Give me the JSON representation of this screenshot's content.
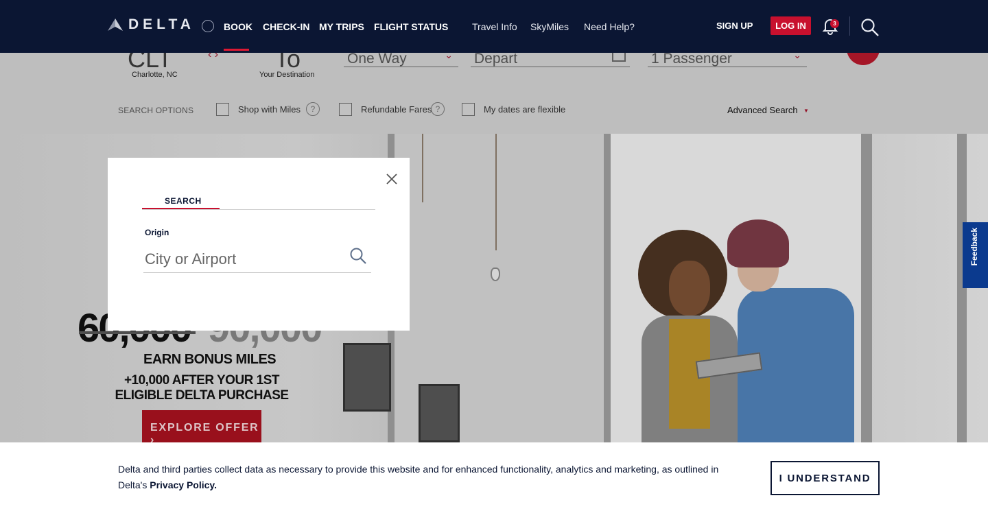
{
  "nav": {
    "brand": "DELTA",
    "items": [
      "BOOK",
      "CHECK-IN",
      "MY TRIPS",
      "FLIGHT STATUS"
    ],
    "secondary": [
      "Travel Info",
      "SkyMiles",
      "Need Help?"
    ],
    "sign_up": "SIGN UP",
    "log_in": "LOG IN",
    "notification_count": "3"
  },
  "booking": {
    "from_code": "CLT",
    "from_city": "Charlotte, NC",
    "to_code": "To",
    "to_city": "Your Destination",
    "trip_type": "One Way",
    "depart": "Depart",
    "passengers": "1 Passenger",
    "search_options_label": "SEARCH OPTIONS",
    "options": [
      "Shop with Miles",
      "Refundable Fares",
      "My dates are flexible"
    ],
    "advanced_search": "Advanced Search"
  },
  "promo": {
    "new_amount": "60,000",
    "old_amount": "90,000",
    "earn": "EARN BONUS MILES",
    "bonus": "+10,000 AFTER YOUR 1ST ELIGIBLE DELTA PURCHASE",
    "cta": "EXPLORE OFFER ›"
  },
  "feedback": "Feedback",
  "modal": {
    "tab": "SEARCH",
    "origin_label": "Origin",
    "origin_placeholder": "City or Airport"
  },
  "cookie": {
    "text": "Delta and third parties collect data as necessary to provide this website and for enhanced functionality, analytics and marketing, as outlined in Delta's ",
    "link": "Privacy Policy.",
    "button": "I UNDERSTAND"
  }
}
